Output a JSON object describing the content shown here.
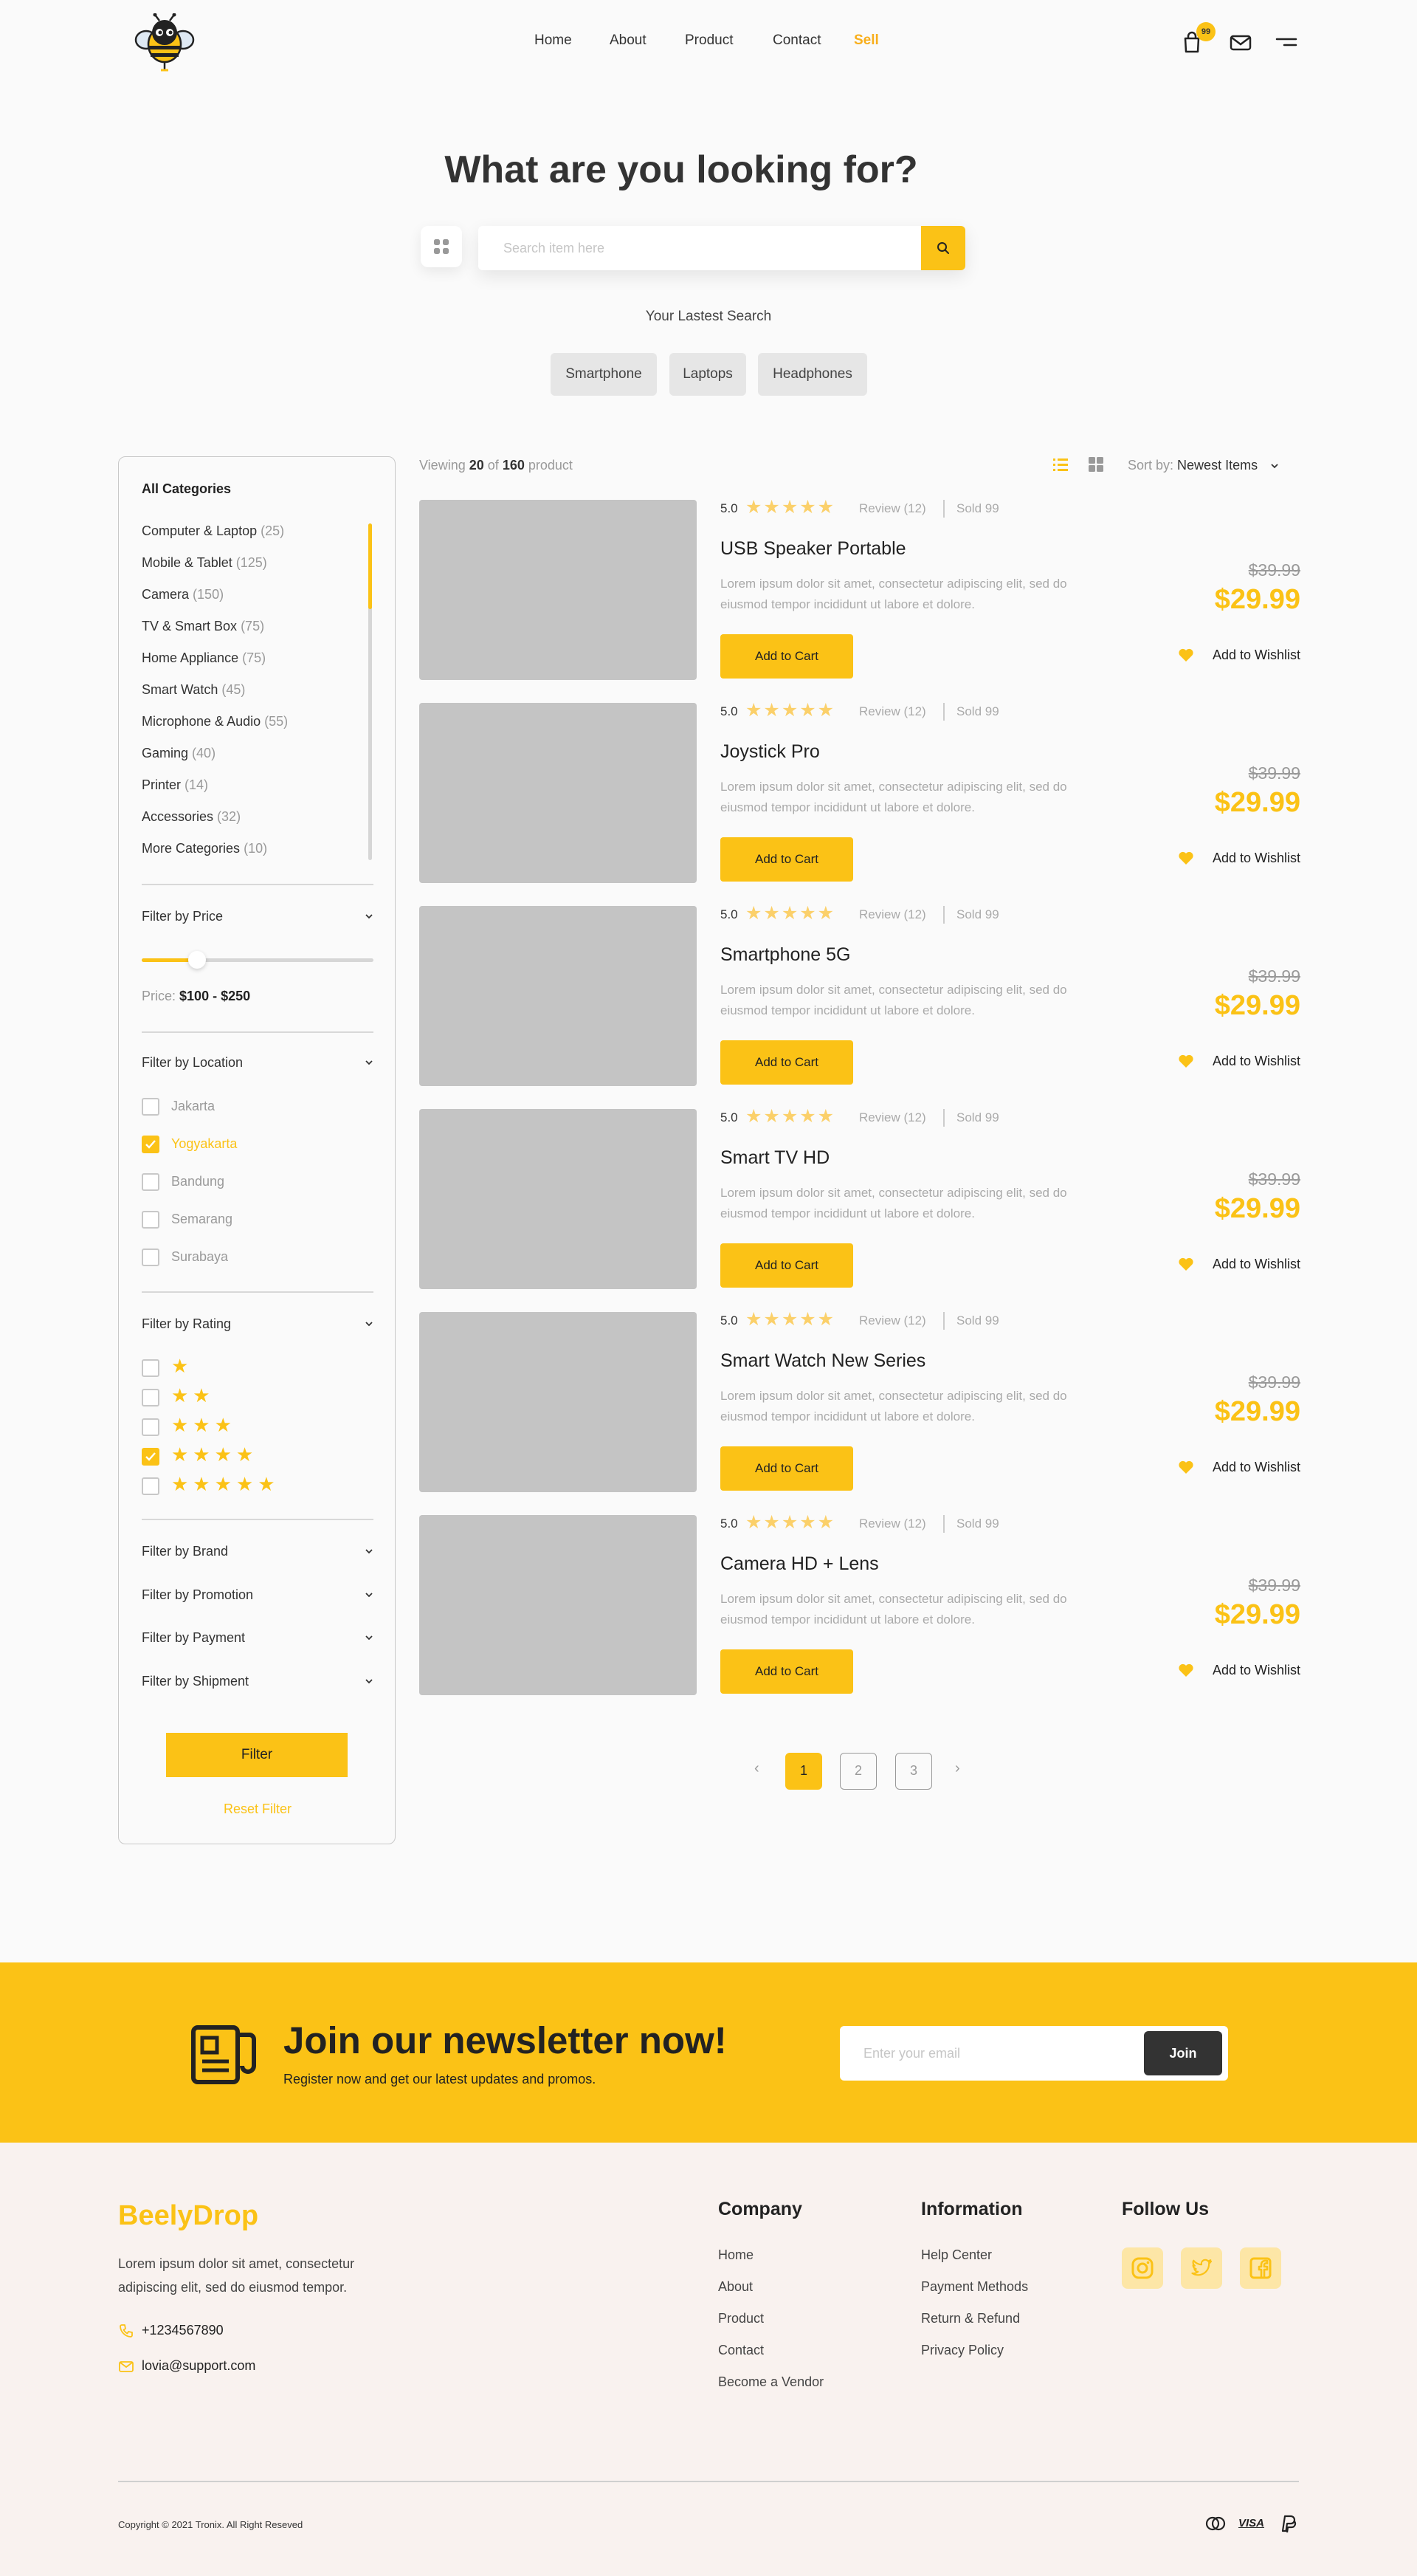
{
  "header": {
    "nav": [
      "Home",
      "About",
      "Product",
      "Contact",
      "Sell"
    ],
    "cart_count": "99"
  },
  "hero": {
    "title": "What are you looking for?",
    "search_placeholder": "Search item here",
    "latest_label": "Your Lastest Search",
    "tags": [
      "Smartphone",
      "Laptops",
      "Headphones"
    ]
  },
  "sidebar": {
    "title": "All Categories",
    "categories": [
      {
        "name": "Computer & Laptop",
        "count": "(25)"
      },
      {
        "name": "Mobile & Tablet",
        "count": "(125)"
      },
      {
        "name": "Camera",
        "count": "(150)"
      },
      {
        "name": "TV & Smart Box",
        "count": "(75)"
      },
      {
        "name": "Home Appliance",
        "count": "(75)"
      },
      {
        "name": "Smart Watch",
        "count": "(45)"
      },
      {
        "name": "Microphone & Audio",
        "count": "(55)"
      },
      {
        "name": "Gaming",
        "count": "(40)"
      },
      {
        "name": "Printer",
        "count": "(14)"
      },
      {
        "name": "Accessories",
        "count": "(32)"
      },
      {
        "name": "More Categories",
        "count": "(10)"
      }
    ],
    "price_filter": "Filter by Price",
    "price_label": "Price:",
    "price_range": "$100 - $250",
    "price_slider_fraction": 0.24,
    "location_filter": "Filter by Location",
    "locations": [
      {
        "name": "Jakarta",
        "checked": false
      },
      {
        "name": "Yogyakarta",
        "checked": true
      },
      {
        "name": "Bandung",
        "checked": false
      },
      {
        "name": "Semarang",
        "checked": false
      },
      {
        "name": "Surabaya",
        "checked": false
      }
    ],
    "rating_filter": "Filter by Rating",
    "ratings": [
      {
        "stars": "★",
        "checked": false
      },
      {
        "stars": "★★",
        "checked": false
      },
      {
        "stars": "★★★",
        "checked": false
      },
      {
        "stars": "★★★★",
        "checked": true
      },
      {
        "stars": "★★★★★",
        "checked": false
      }
    ],
    "brand_filter": "Filter by Brand",
    "promotion_filter": "Filter by Promotion",
    "payment_filter": "Filter by Payment",
    "shipment_filter": "Filter by Shipment",
    "filter_button": "Filter",
    "reset_button": "Reset Filter"
  },
  "toolbar": {
    "viewing_prefix": "Viewing",
    "viewing_count": "20",
    "viewing_of": "of",
    "viewing_total": "160",
    "viewing_suffix": "product",
    "sort_label": "Sort by:",
    "sort_value": "Newest Items"
  },
  "products": [
    {
      "rating": "5.0",
      "stars": "★★★★★",
      "review": "Review (12)",
      "sold": "Sold 99",
      "name": "USB Speaker Portable",
      "description": "Lorem ipsum dolor sit amet, consectetur adipiscing elit, sed do eiusmod tempor incididunt ut labore et dolore.",
      "cart": "Add to Cart",
      "old_price": "$39.99",
      "price": "$29.99",
      "wishlist": "Add to Wishlist"
    },
    {
      "rating": "5.0",
      "stars": "★★★★★",
      "review": "Review (12)",
      "sold": "Sold 99",
      "name": "Joystick Pro",
      "description": "Lorem ipsum dolor sit amet, consectetur adipiscing elit, sed do eiusmod tempor incididunt ut labore et dolore.",
      "cart": "Add to Cart",
      "old_price": "$39.99",
      "price": "$29.99",
      "wishlist": "Add to Wishlist"
    },
    {
      "rating": "5.0",
      "stars": "★★★★★",
      "review": "Review (12)",
      "sold": "Sold 99",
      "name": "Smartphone 5G",
      "description": "Lorem ipsum dolor sit amet, consectetur adipiscing elit, sed do eiusmod tempor incididunt ut labore et dolore.",
      "cart": "Add to Cart",
      "old_price": "$39.99",
      "price": "$29.99",
      "wishlist": "Add to Wishlist"
    },
    {
      "rating": "5.0",
      "stars": "★★★★★",
      "review": "Review (12)",
      "sold": "Sold 99",
      "name": "Smart TV HD",
      "description": "Lorem ipsum dolor sit amet, consectetur adipiscing elit, sed do eiusmod tempor incididunt ut labore et dolore.",
      "cart": "Add to Cart",
      "old_price": "$39.99",
      "price": "$29.99",
      "wishlist": "Add to Wishlist"
    },
    {
      "rating": "5.0",
      "stars": "★★★★★",
      "review": "Review (12)",
      "sold": "Sold 99",
      "name": "Smart Watch New Series",
      "description": "Lorem ipsum dolor sit amet, consectetur adipiscing elit, sed do eiusmod tempor incididunt ut labore et dolore.",
      "cart": "Add to Cart",
      "old_price": "$39.99",
      "price": "$29.99",
      "wishlist": "Add to Wishlist"
    },
    {
      "rating": "5.0",
      "stars": "★★★★★",
      "review": "Review (12)",
      "sold": "Sold 99",
      "name": "Camera HD + Lens",
      "description": "Lorem ipsum dolor sit amet, consectetur adipiscing elit, sed do eiusmod tempor incididunt ut labore et dolore.",
      "cart": "Add to Cart",
      "old_price": "$39.99",
      "price": "$29.99",
      "wishlist": "Add to Wishlist"
    }
  ],
  "pagination": {
    "prev": "‹",
    "pages": [
      "1",
      "2",
      "3"
    ],
    "next": "›"
  },
  "newsletter": {
    "title": "Join our newsletter now!",
    "subtitle": "Register now and get our latest updates and promos.",
    "placeholder": "Enter your email",
    "button": "Join"
  },
  "footer": {
    "brand": "BeelyDrop",
    "description": "Lorem ipsum dolor sit amet, consectetur adipiscing elit, sed do eiusmod tempor.",
    "phone": "+1234567890",
    "email": "lovia@support.com",
    "company_title": "Company",
    "company_links": [
      "Home",
      "About",
      "Product",
      "Contact",
      "Become a Vendor"
    ],
    "info_title": "Information",
    "info_links": [
      "Help Center",
      "Payment Methods",
      "Return & Refund",
      "Privacy Policy"
    ],
    "follow_title": "Follow Us",
    "copyright": "Copyright © 2021 Tronix. All Right Reseved",
    "visa": "VISA"
  },
  "colors": {
    "accent": "#fbc216",
    "dark": "#333333",
    "footer_bg": "#f9f2ef"
  }
}
